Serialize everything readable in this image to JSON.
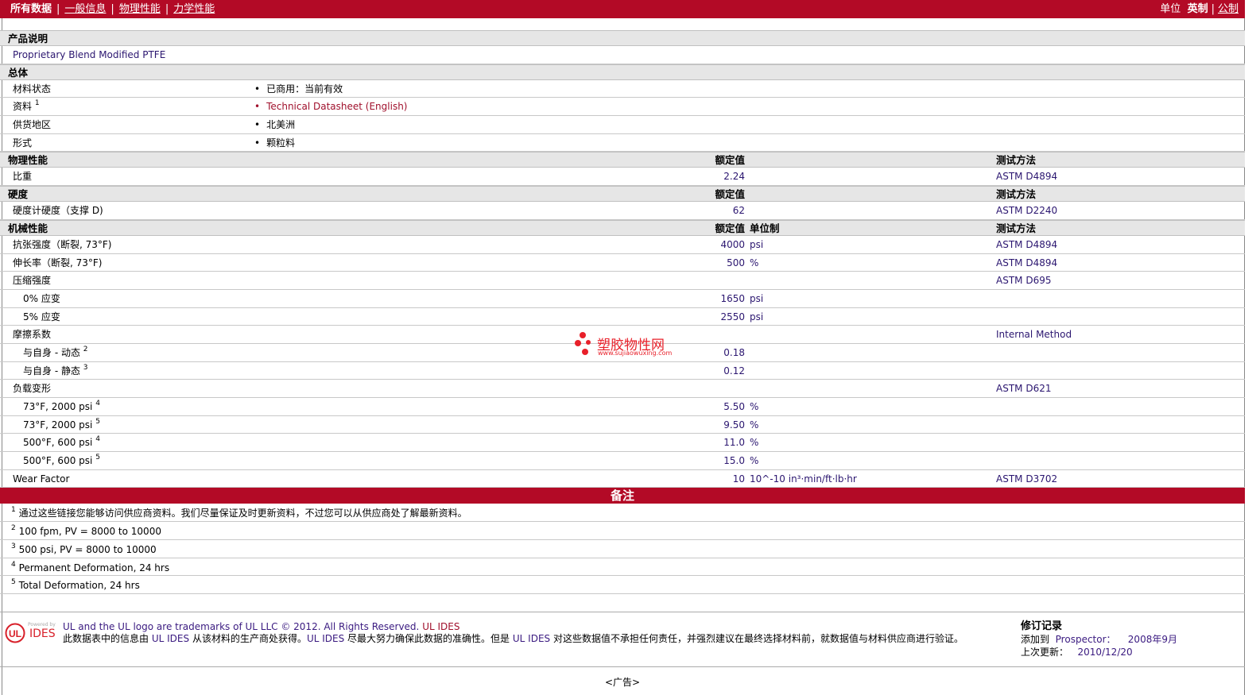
{
  "nav": {
    "all": "所有数据",
    "general": "一般信息",
    "physical": "物理性能",
    "mechanical": "力学性能",
    "unit_label": "单位",
    "imperial": "英制",
    "metric": "公制"
  },
  "rows": [
    {
      "t": "sec",
      "label": "产品说明"
    },
    {
      "t": "row",
      "label": "Proprietary Blend Modified PTFE",
      "dark": true
    },
    {
      "t": "sec",
      "label": "总体"
    },
    {
      "t": "bul",
      "label": "材料状态",
      "value": "已商用：当前有效"
    },
    {
      "t": "bul",
      "label": "资料",
      "sup": "1",
      "value": "Technical Datasheet (English)",
      "link": true
    },
    {
      "t": "bul",
      "label": "供货地区",
      "value": "北美洲"
    },
    {
      "t": "bul",
      "label": "形式",
      "value": "颗粒料"
    },
    {
      "t": "sec",
      "label": "物理性能",
      "value": "额定值",
      "method": "测试方法"
    },
    {
      "t": "row",
      "label": "比重",
      "value": "2.24",
      "method": "ASTM D4894"
    },
    {
      "t": "sec",
      "label": "硬度",
      "value": "额定值",
      "method": "测试方法"
    },
    {
      "t": "row",
      "label": "硬度计硬度（支撑 D)",
      "value": "62",
      "method": "ASTM D2240"
    },
    {
      "t": "sec",
      "label": "机械性能",
      "value": "额定值",
      "unit": "单位制",
      "method": "测试方法"
    },
    {
      "t": "row",
      "label": "抗张强度（断裂, 73°F)",
      "value": "4000",
      "unit": "psi",
      "method": "ASTM D4894"
    },
    {
      "t": "row",
      "label": "伸长率（断裂, 73°F)",
      "value": "500",
      "unit": "%",
      "method": "ASTM D4894"
    },
    {
      "t": "row",
      "label": "压缩强度",
      "method": "ASTM D695"
    },
    {
      "t": "row",
      "label": "0% 应变",
      "ind": true,
      "value": "1650",
      "unit": "psi"
    },
    {
      "t": "row",
      "label": "5% 应变",
      "ind": true,
      "value": "2550",
      "unit": "psi"
    },
    {
      "t": "row",
      "label": "摩擦系数",
      "method": "Internal Method"
    },
    {
      "t": "row",
      "label": "与自身 - 动态",
      "sup": "2",
      "ind": true,
      "value": "0.18"
    },
    {
      "t": "row",
      "label": "与自身 - 静态",
      "sup": "3",
      "ind": true,
      "value": "0.12"
    },
    {
      "t": "row",
      "label": "负载变形",
      "method": "ASTM D621"
    },
    {
      "t": "row",
      "label": "73°F, 2000 psi",
      "sup": "4",
      "ind": true,
      "value": "5.50",
      "unit": "%"
    },
    {
      "t": "row",
      "label": "73°F, 2000 psi",
      "sup": "5",
      "ind": true,
      "value": "9.50",
      "unit": "%"
    },
    {
      "t": "row",
      "label": "500°F, 600 psi",
      "sup": "4",
      "ind": true,
      "value": "11.0",
      "unit": "%"
    },
    {
      "t": "row",
      "label": "500°F, 600 psi",
      "sup": "5",
      "ind": true,
      "value": "15.0",
      "unit": "%"
    },
    {
      "t": "row",
      "label": "Wear Factor",
      "value": "10",
      "unit": "10^-10 in³·min/ft·lb·hr",
      "method": "ASTM D3702"
    }
  ],
  "notes_title": "备注",
  "footnotes": [
    {
      "n": "1",
      "text": "通过这些链接您能够访问供应商资料。我们尽量保证及时更新资料，不过您可以从供应商处了解最新资料。"
    },
    {
      "n": "2",
      "text": "100 fpm, PV = 8000 to 10000"
    },
    {
      "n": "3",
      "text": "500 psi, PV = 8000 to 10000"
    },
    {
      "n": "4",
      "text": "Permanent Deformation, 24 hrs"
    },
    {
      "n": "5",
      "text": "Total Deformation, 24 hrs"
    }
  ],
  "footer": {
    "logo_powered": "Powered by",
    "logo_ides": "IDES",
    "logo_ul": "UL",
    "line1": "UL and the UL logo are trademarks of UL LLC © 2012. All Rights Reserved.",
    "line1_link": "UL IDES",
    "p1": "此数据表中的信息由",
    "ul1": "UL IDES",
    "p2": "从该材料的生产商处获得。",
    "ul2": "UL IDES",
    "p3": "尽最大努力确保此数据的准确性。但是",
    "ul3": "UL IDES",
    "p4": "对这些数据值不承担任何责任，并强烈建议在最终选择材料前，就数据值与材料供应商进行验证。",
    "rev_title": "修订记录",
    "added_label": "添加到",
    "added_link": "Prospector：",
    "added_date": "2008年9月",
    "updated_label": "上次更新：",
    "updated_date": "2010/12/20"
  },
  "watermark": {
    "name": "塑胶物性网",
    "url": "www.sujiaowuxing.com"
  },
  "ad": "<广告>",
  "colors": {
    "brand": "#b30a26",
    "value": "#2b1670"
  }
}
